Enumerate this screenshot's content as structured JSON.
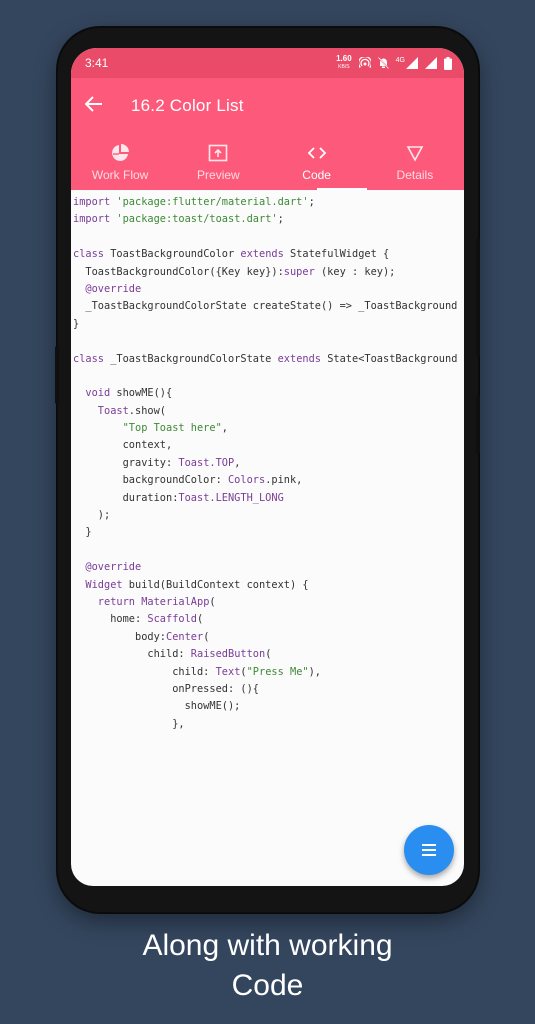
{
  "status": {
    "time": "3:41",
    "net_speed": "1.60",
    "net_unit": "KB/S",
    "network": "4G"
  },
  "appbar": {
    "title": "16.2 Color List"
  },
  "tabs": [
    {
      "label": "Work Flow",
      "icon": "pie-chart-icon"
    },
    {
      "label": "Preview",
      "icon": "preview-icon"
    },
    {
      "label": "Code",
      "icon": "code-icon",
      "active": true
    },
    {
      "label": "Details",
      "icon": "triangle-icon"
    }
  ],
  "code_lines": [
    [
      [
        "k",
        "import "
      ],
      [
        "s",
        "'package:flutter/material.dart'"
      ],
      [
        "",
        "; "
      ]
    ],
    [
      [
        "k",
        "import "
      ],
      [
        "s",
        "'package:toast/toast.dart'"
      ],
      [
        "",
        ";"
      ]
    ],
    [],
    [
      [
        "k",
        "class "
      ],
      [
        "",
        "ToastBackgroundColor "
      ],
      [
        "k",
        "extends "
      ],
      [
        "",
        "StatefulWidget {"
      ]
    ],
    [
      [
        "",
        "  ToastBackgroundColor({Key key}):"
      ],
      [
        "k",
        "super"
      ],
      [
        "",
        " (key : key);"
      ]
    ],
    [
      [
        "k",
        "  @override"
      ]
    ],
    [
      [
        "",
        "  _ToastBackgroundColorState createState() => _ToastBackground"
      ]
    ],
    [
      [
        "",
        "}"
      ]
    ],
    [],
    [
      [
        "k",
        "class "
      ],
      [
        "",
        "_ToastBackgroundColorState "
      ],
      [
        "k",
        "extends "
      ],
      [
        "",
        "State<ToastBackground"
      ]
    ],
    [],
    [
      [
        "k",
        "  void "
      ],
      [
        "",
        "showME(){"
      ]
    ],
    [
      [
        "t",
        "    Toast"
      ],
      [
        "",
        ".show("
      ]
    ],
    [
      [
        "s",
        "        \"Top Toast here\""
      ],
      [
        "",
        ","
      ]
    ],
    [
      [
        "",
        "        context,"
      ]
    ],
    [
      [
        "",
        "        gravity: "
      ],
      [
        "t",
        "Toast.TOP"
      ],
      [
        "",
        ","
      ]
    ],
    [
      [
        "",
        "        backgroundColor: "
      ],
      [
        "t",
        "Colors"
      ],
      [
        "",
        ".pink,"
      ]
    ],
    [
      [
        "",
        "        duration:"
      ],
      [
        "t",
        "Toast.LENGTH_LONG"
      ]
    ],
    [
      [
        "",
        "    );"
      ]
    ],
    [
      [
        "",
        "  }"
      ]
    ],
    [],
    [
      [
        "k",
        "  @override"
      ]
    ],
    [
      [
        "t",
        "  Widget "
      ],
      [
        "",
        "build(BuildContext context) {"
      ]
    ],
    [
      [
        "k",
        "    return "
      ],
      [
        "t",
        "MaterialApp"
      ],
      [
        "",
        "("
      ]
    ],
    [
      [
        "",
        "      home: "
      ],
      [
        "t",
        "Scaffold"
      ],
      [
        "",
        "("
      ]
    ],
    [
      [
        "",
        "          body:"
      ],
      [
        "t",
        "Center"
      ],
      [
        "",
        "("
      ]
    ],
    [
      [
        "",
        "            child: "
      ],
      [
        "t",
        "RaisedButton"
      ],
      [
        "",
        "("
      ]
    ],
    [
      [
        "",
        "                child: "
      ],
      [
        "t",
        "Text"
      ],
      [
        "",
        "("
      ],
      [
        "s",
        "\"Press Me\""
      ],
      [
        "",
        "),"
      ]
    ],
    [
      [
        "",
        "                onPressed: (){"
      ]
    ],
    [
      [
        "",
        "                  showME();"
      ]
    ],
    [
      [
        "",
        "                },"
      ]
    ]
  ],
  "fab": {
    "icon": "menu-icon"
  },
  "caption": {
    "line1": "Along with working",
    "line2": "Code"
  }
}
